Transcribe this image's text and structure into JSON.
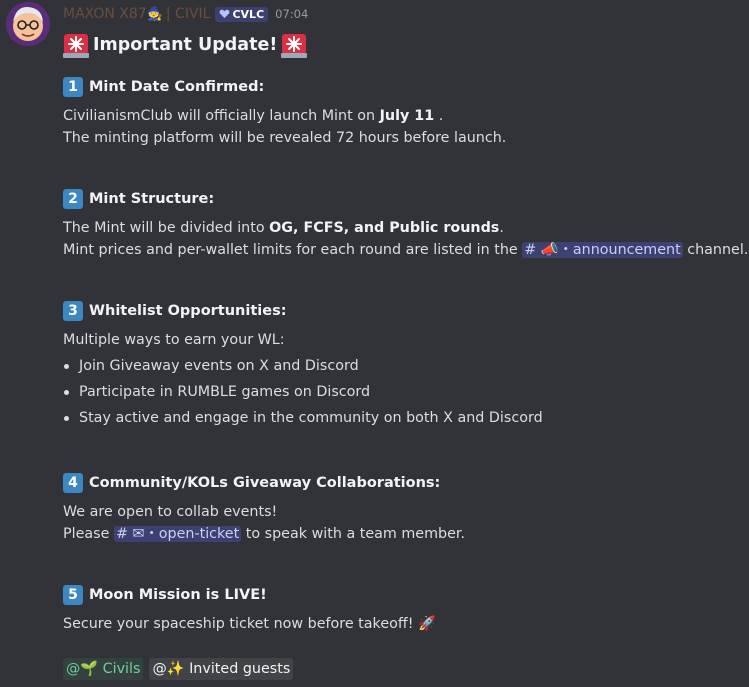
{
  "message": {
    "author": "MAXON X87",
    "author_emoji": "🧙",
    "author_tag": "| CIVIL",
    "badge": "CVLC",
    "timestamp": "07:04",
    "title": "Important Update!",
    "sections": [
      {
        "number": "1",
        "heading": "Mint Date Confirmed:",
        "line1_prefix": "CivilianismClub will officially launch Mint on ",
        "line1_bold": "July 11",
        "line1_suffix": " .",
        "line2": "The minting platform will be revealed 72 hours before launch."
      },
      {
        "number": "2",
        "heading": "Mint Structure:",
        "line1_prefix": "The Mint will be divided into ",
        "line1_bold": "OG, FCFS, and Public rounds",
        "line1_suffix": ".",
        "line2_prefix": "Mint prices and per-wallet limits for each round are listed in the ",
        "channel": "📣・announcement",
        "line2_suffix": " channel."
      },
      {
        "number": "3",
        "heading": "Whitelist Opportunities:",
        "intro": "Multiple ways to earn your WL:",
        "bullets": [
          "Join Giveaway events on X and Discord",
          "Participate in RUMBLE games on Discord",
          "Stay active and engage in the community on both X and Discord"
        ]
      },
      {
        "number": "4",
        "heading": "Community/KOLs Giveaway Collaborations:",
        "line1": "We are open to collab events!",
        "line2_prefix": "Please ",
        "channel": "✉・open-ticket",
        "line2_suffix": " to speak with a team member."
      },
      {
        "number": "5",
        "heading": "Moon Mission is LIVE!",
        "line1": "Secure your spaceship ticket now before takeoff! 🚀"
      }
    ],
    "roles": [
      {
        "label": "@🌱 Civils",
        "color": "#6fcf97"
      },
      {
        "label": "@✨ Invited guests",
        "color": "#f2f3f5"
      }
    ]
  },
  "colors": {
    "background": "#313338",
    "mention_bg": "#3c4370",
    "keycap": "#3b88c3",
    "username": "#6d4d3e"
  }
}
